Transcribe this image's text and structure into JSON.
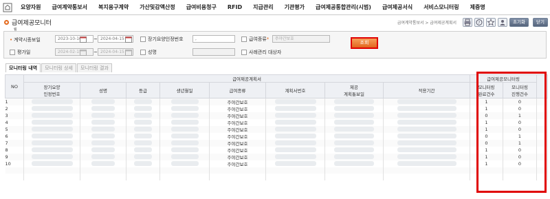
{
  "nav": {
    "items": [
      "요양자원",
      "급여계약통보서",
      "복지용구계약",
      "가산및감액산정",
      "급여비용청구",
      "RFID",
      "지급관리",
      "기관평가",
      "급여제공통합관리(시범)",
      "급여제공서식",
      "서비스모니터링",
      "제증명"
    ]
  },
  "header": {
    "title": "급여제공모니터",
    "subtitle": "링",
    "breadcrumb": "급여계약통보서 > 급여제공계획서",
    "btn_init": "초기화",
    "btn_close": "닫기"
  },
  "search": {
    "contract_period_label": "계약시종보일",
    "contract_from": "2023-10-16",
    "contract_to": "2024-04-15",
    "eval_date_label": "평가일",
    "eval_from": "2024-02-15",
    "eval_to": "2024-04-15",
    "ltc_no_label": "장기요양인정번호",
    "name_label": "성명",
    "benefit_type_label": "급여종류",
    "benefit_type_value": "주야간보호",
    "case_mgmt_label": "사례관리 대상자",
    "search_button": "조회"
  },
  "tabs": [
    "모니터링 내역",
    "모니터링 상세",
    "모니터링 결과"
  ],
  "table": {
    "group_plan": "급여제공계획서",
    "group_monitor": "급여제공모니터링",
    "col_no": "NO",
    "col_ltc": "장기요양\n인정번호",
    "col_name": "성명",
    "col_grade": "등급",
    "col_birth": "생년월일",
    "col_type": "급여종류",
    "col_plan_no": "계획서번호",
    "col_notice_date": "제공\n계획통보일",
    "col_period": "적용기간",
    "col_done": "모니터링\n완료건수",
    "col_progress": "모니터링\n진행건수",
    "rows": [
      {
        "no": "1",
        "type": "주야간보호",
        "done": "1",
        "progress": "0"
      },
      {
        "no": "2",
        "type": "주야간보호",
        "done": "1",
        "progress": "0"
      },
      {
        "no": "3",
        "type": "주야간보호",
        "done": "0",
        "progress": "1"
      },
      {
        "no": "4",
        "type": "주야간보호",
        "done": "1",
        "progress": "0"
      },
      {
        "no": "5",
        "type": "주야간보호",
        "done": "1",
        "progress": "0"
      },
      {
        "no": "6",
        "type": "주야간보호",
        "done": "0",
        "progress": "1"
      },
      {
        "no": "7",
        "type": "주야간보호",
        "done": "0",
        "progress": "1"
      },
      {
        "no": "8",
        "type": "주야간보호",
        "done": "1",
        "progress": "0"
      },
      {
        "no": "9",
        "type": "주야간보호",
        "done": "1",
        "progress": "0"
      },
      {
        "no": "10",
        "type": "주야간보호",
        "done": "1",
        "progress": "0"
      }
    ]
  },
  "colors": {
    "accent": "#e46a1e",
    "highlight": "#e00000"
  }
}
